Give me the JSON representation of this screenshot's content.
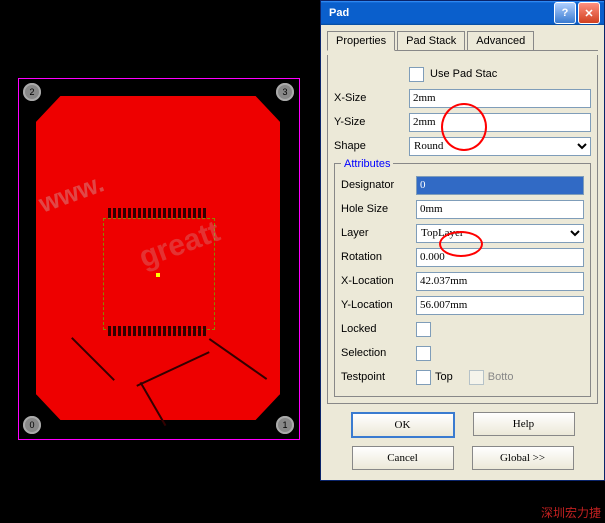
{
  "dialog": {
    "title": "Pad",
    "tabs": {
      "properties": "Properties",
      "padstack": "Pad Stack",
      "advanced": "Advanced"
    },
    "usePadStack": "Use Pad Stac",
    "xsize": {
      "label": "X-Size",
      "value": "2mm"
    },
    "ysize": {
      "label": "Y-Size",
      "value": "2mm"
    },
    "shape": {
      "label": "Shape",
      "value": "Round"
    },
    "attributes": {
      "title": "Attributes",
      "designator": {
        "label": "Designator",
        "value": "0"
      },
      "holesize": {
        "label": "Hole Size",
        "value": "0mm"
      },
      "layer": {
        "label": "Layer",
        "value": "TopLayer"
      },
      "rotation": {
        "label": "Rotation",
        "value": "0.000"
      },
      "xloc": {
        "label": "X-Location",
        "value": "42.037mm"
      },
      "yloc": {
        "label": "Y-Location",
        "value": "56.007mm"
      },
      "locked": "Locked",
      "selection": "Selection",
      "testpoint": "Testpoint",
      "top": "Top",
      "bottom": "Botto"
    },
    "buttons": {
      "ok": "OK",
      "help": "Help",
      "cancel": "Cancel",
      "global": "Global >>"
    }
  },
  "pcb": {
    "via0": "0",
    "via1": "1",
    "via2": "2",
    "via3": "3"
  },
  "watermark1": "www.",
  "watermark2": "greatt",
  "bottomText": "深圳宏力捷"
}
